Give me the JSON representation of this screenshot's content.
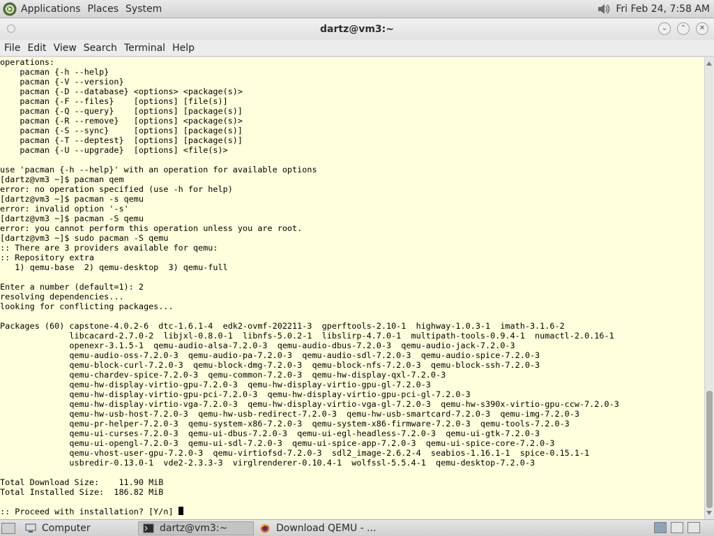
{
  "top_panel": {
    "menus": [
      "Applications",
      "Places",
      "System"
    ],
    "clock": "Fri Feb 24,  7:58 AM",
    "icons": {
      "logo": "distro-logo-icon",
      "volume": "volume-icon"
    }
  },
  "window": {
    "title": "dartz@vm3:~",
    "buttons": {
      "minimize": "minimize-icon",
      "maximize": "maximize-icon",
      "close": "close-icon"
    }
  },
  "menubar": [
    "File",
    "Edit",
    "View",
    "Search",
    "Terminal",
    "Help"
  ],
  "terminal": {
    "colors": {
      "background": "#ffffdd",
      "text": "#000000"
    },
    "lines": [
      "operations:",
      "    pacman {-h --help}",
      "    pacman {-V --version}",
      "    pacman {-D --database} <options> <package(s)>",
      "    pacman {-F --files}    [options] [file(s)]",
      "    pacman {-Q --query}    [options] [package(s)]",
      "    pacman {-R --remove}   [options] <package(s)>",
      "    pacman {-S --sync}     [options] [package(s)]",
      "    pacman {-T --deptest}  [options] [package(s)]",
      "    pacman {-U --upgrade}  [options] <file(s)>",
      "",
      "use 'pacman {-h --help}' with an operation for available options",
      "[dartz@vm3 ~]$ pacman qem",
      "error: no operation specified (use -h for help)",
      "[dartz@vm3 ~]$ pacman -s qemu",
      "error: invalid option '-s'",
      "[dartz@vm3 ~]$ pacman -S qemu",
      "error: you cannot perform this operation unless you are root.",
      "[dartz@vm3 ~]$ sudo pacman -S qemu",
      ":: There are 3 providers available for qemu:",
      ":: Repository extra",
      "   1) qemu-base  2) qemu-desktop  3) qemu-full",
      "",
      "Enter a number (default=1): 2",
      "resolving dependencies...",
      "looking for conflicting packages...",
      "",
      "Packages (60) capstone-4.0.2-6  dtc-1.6.1-4  edk2-ovmf-202211-3  gperftools-2.10-1  highway-1.0.3-1  imath-3.1.6-2",
      "              libcacard-2.7.0-2  libjxl-0.8.0-1  libnfs-5.0.2-1  libslirp-4.7.0-1  multipath-tools-0.9.4-1  numactl-2.0.16-1",
      "              openexr-3.1.5-1  qemu-audio-alsa-7.2.0-3  qemu-audio-dbus-7.2.0-3  qemu-audio-jack-7.2.0-3",
      "              qemu-audio-oss-7.2.0-3  qemu-audio-pa-7.2.0-3  qemu-audio-sdl-7.2.0-3  qemu-audio-spice-7.2.0-3",
      "              qemu-block-curl-7.2.0-3  qemu-block-dmg-7.2.0-3  qemu-block-nfs-7.2.0-3  qemu-block-ssh-7.2.0-3",
      "              qemu-chardev-spice-7.2.0-3  qemu-common-7.2.0-3  qemu-hw-display-qxl-7.2.0-3",
      "              qemu-hw-display-virtio-gpu-7.2.0-3  qemu-hw-display-virtio-gpu-gl-7.2.0-3",
      "              qemu-hw-display-virtio-gpu-pci-7.2.0-3  qemu-hw-display-virtio-gpu-pci-gl-7.2.0-3",
      "              qemu-hw-display-virtio-vga-7.2.0-3  qemu-hw-display-virtio-vga-gl-7.2.0-3  qemu-hw-s390x-virtio-gpu-ccw-7.2.0-3",
      "              qemu-hw-usb-host-7.2.0-3  qemu-hw-usb-redirect-7.2.0-3  qemu-hw-usb-smartcard-7.2.0-3  qemu-img-7.2.0-3",
      "              qemu-pr-helper-7.2.0-3  qemu-system-x86-7.2.0-3  qemu-system-x86-firmware-7.2.0-3  qemu-tools-7.2.0-3",
      "              qemu-ui-curses-7.2.0-3  qemu-ui-dbus-7.2.0-3  qemu-ui-egl-headless-7.2.0-3  qemu-ui-gtk-7.2.0-3",
      "              qemu-ui-opengl-7.2.0-3  qemu-ui-sdl-7.2.0-3  qemu-ui-spice-app-7.2.0-3  qemu-ui-spice-core-7.2.0-3",
      "              qemu-vhost-user-gpu-7.2.0-3  qemu-virtiofsd-7.2.0-3  sdl2_image-2.6.2-4  seabios-1.16.1-1  spice-0.15.1-1",
      "              usbredir-0.13.0-1  vde2-2.3.3-3  virglrenderer-0.10.4-1  wolfssl-5.5.4-1  qemu-desktop-7.2.0-3",
      "",
      "Total Download Size:    11.90 MiB",
      "Total Installed Size:  186.82 MiB",
      "",
      ":: Proceed with installation? [Y/n] "
    ]
  },
  "taskbar": {
    "tasks": [
      {
        "label": "Computer",
        "icon": "computer-icon"
      },
      {
        "label": "dartz@vm3:~",
        "icon": "terminal-icon"
      },
      {
        "label": "Download QEMU - ...",
        "icon": "firefox-icon"
      }
    ]
  }
}
